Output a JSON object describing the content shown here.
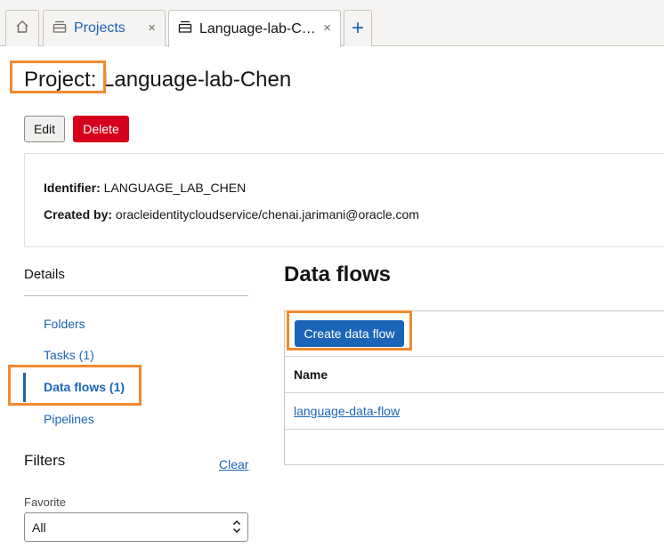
{
  "tabs": {
    "projects_label": "Projects",
    "active_label": "Language-lab-C…",
    "close_glyph": "×",
    "add_glyph": "+"
  },
  "header": {
    "title": "Project: Language-lab-Chen"
  },
  "actions": {
    "edit_label": "Edit",
    "delete_label": "Delete"
  },
  "info": {
    "identifier_label": "Identifier:",
    "identifier_value": "LANGUAGE_LAB_CHEN",
    "created_by_label": "Created by:",
    "created_by_value": "oracleidentitycloudservice/chenai.jarimani@oracle.com"
  },
  "sidebar": {
    "heading": "Details",
    "items": [
      {
        "label": "Folders"
      },
      {
        "label": "Tasks (1)"
      },
      {
        "label": "Data flows (1)"
      },
      {
        "label": "Pipelines"
      }
    ],
    "active_index": 2
  },
  "filters": {
    "heading": "Filters",
    "clear_label": "Clear",
    "favorite_label": "Favorite",
    "favorite_value": "All"
  },
  "main": {
    "title": "Data flows",
    "create_label": "Create data flow",
    "column_name": "Name",
    "rows": [
      {
        "name": "language-data-flow"
      }
    ]
  },
  "icons": {
    "home": "home-icon",
    "tab": "tab-stack-icon"
  },
  "colors": {
    "accent": "#1b65b8",
    "danger": "#d6001c",
    "highlight": "#f28a2e"
  }
}
